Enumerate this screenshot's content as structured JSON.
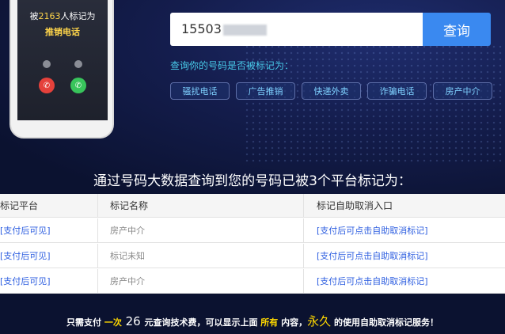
{
  "phone": {
    "text_prefix": "被",
    "count": "2163",
    "text_suffix": "人标记为",
    "label": "推销电话"
  },
  "search": {
    "value": "15503",
    "button_label": "查询"
  },
  "query_label": "查询你的号码是否被标记为：",
  "tags": [
    "骚扰电话",
    "广告推销",
    "快递外卖",
    "诈骗电话",
    "房产中介"
  ],
  "headline": "通过号码大数据查询到您的号码已被3个平台标记为：",
  "table": {
    "headers": [
      "标记平台",
      "标记名称",
      "标记自助取消入口"
    ],
    "rows": [
      [
        "[支付后可见]",
        "房产中介",
        "[支付后可点击自助取消标记]"
      ],
      [
        "[支付后可见]",
        "标记未知",
        "[支付后可点击自助取消标记]"
      ],
      [
        "[支付后可见]",
        "房产中介",
        "[支付后可点击自助取消标记]"
      ]
    ]
  },
  "footer": {
    "p1": "只需支付 ",
    "once": "一次",
    "price": " 26 ",
    "p2": "元查询技术费，可以显示上面 ",
    "all": "所有",
    "p3": " 内容，",
    "forever": "永久",
    "p4": " 的使用自助取消标记服务！"
  },
  "colors": {
    "background": "#0b1230",
    "accent": "#3a89f0",
    "link": "#2d5ee0",
    "highlight": "#ffd800"
  }
}
